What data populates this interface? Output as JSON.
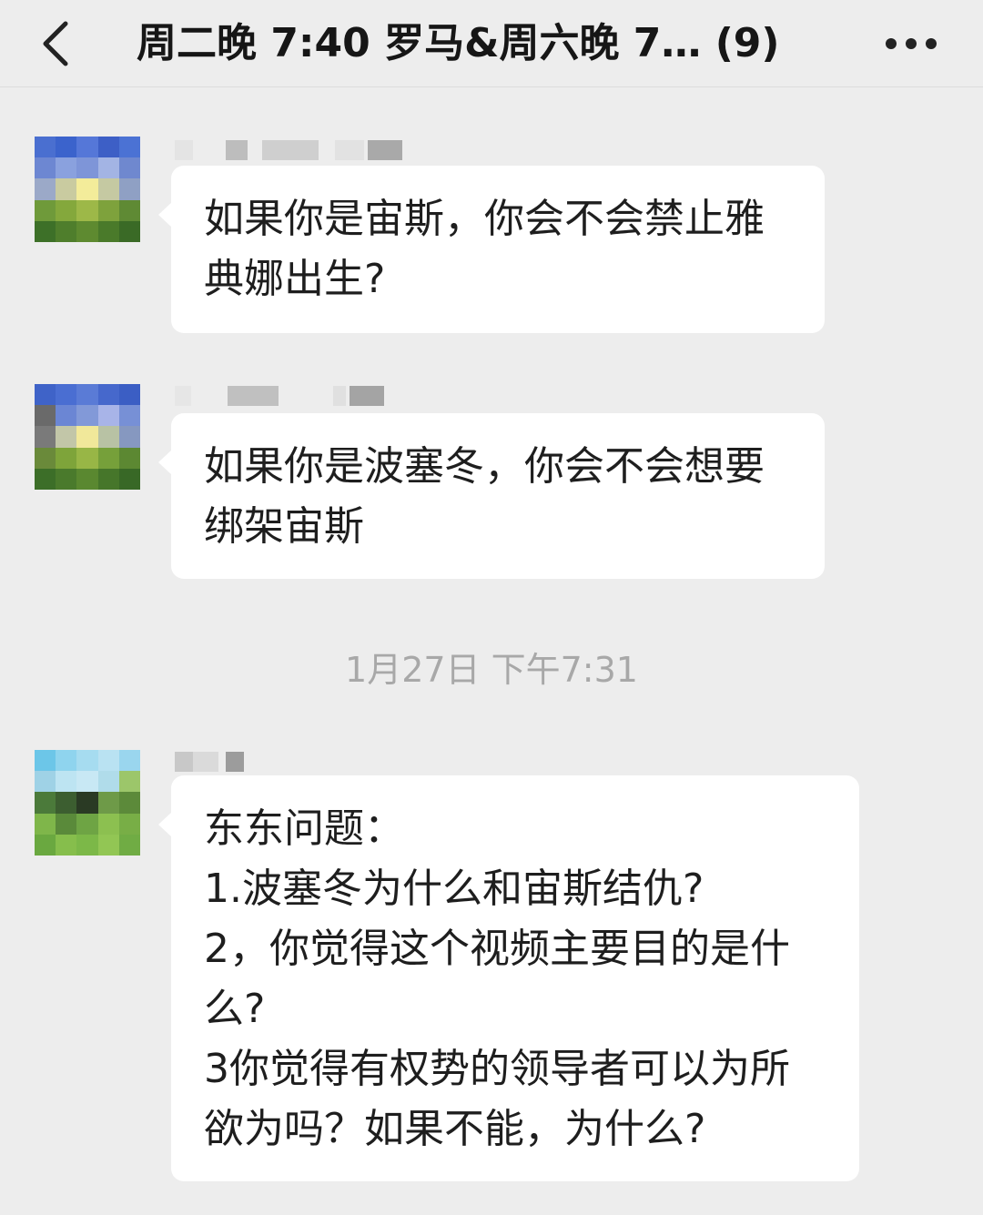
{
  "header": {
    "back_icon": "chevron-left-icon",
    "title": "周二晚 7:40 罗马&周六晚 7… (9)",
    "more_icon": "more-horizontal-icon"
  },
  "messages": [
    {
      "text": "如果你是宙斯，你会不会禁止雅典娜出生?"
    },
    {
      "text": "如果你是波塞冬，你会不会想要绑架宙斯"
    },
    {
      "text": "东东问题：\n1.波塞冬为什么和宙斯结仇?\n2，你觉得这个视频主要目的是什么?\n3你觉得有权势的领导者可以为所欲为吗？如果不能，为什么?"
    }
  ],
  "timestamp": "1月27日 下午7:31",
  "colors": {
    "background": "#ededed",
    "bubble": "#ffffff",
    "timestamp_text": "#a8a8a8"
  }
}
